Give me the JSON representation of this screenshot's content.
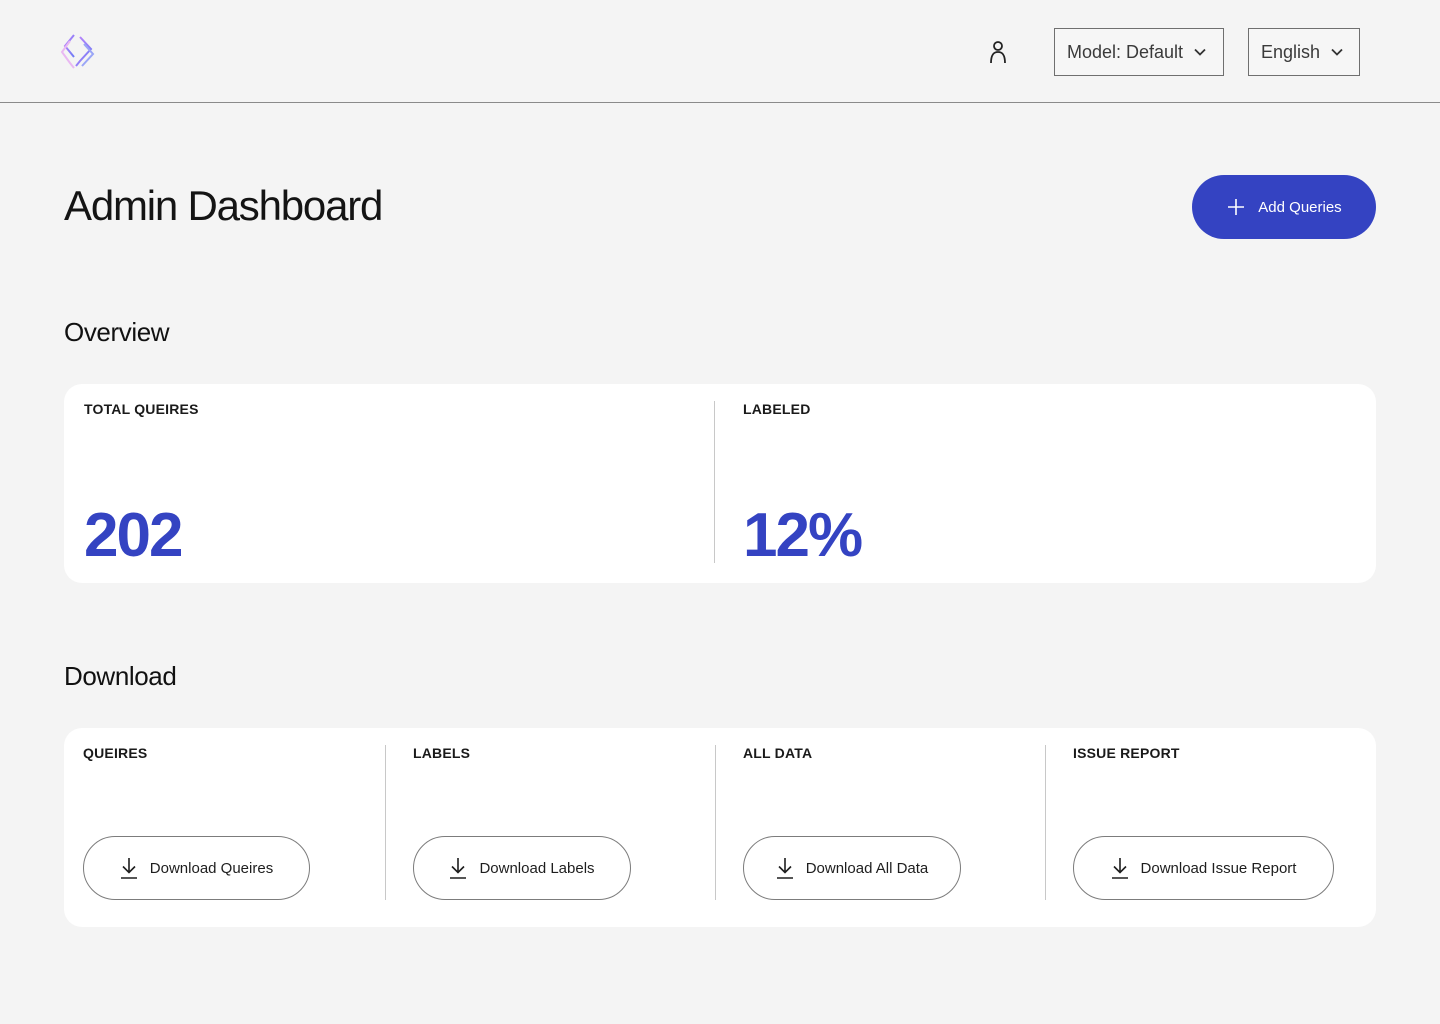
{
  "header": {
    "logo_icon": "logo-chevrons-icon",
    "user_icon": "user-icon",
    "model_select": {
      "value": "Model: Default"
    },
    "language_select": {
      "value": "English"
    }
  },
  "page": {
    "title": "Admin Dashboard",
    "add_button": {
      "label": "Add Queries",
      "icon": "plus-icon"
    }
  },
  "overview": {
    "title": "Overview",
    "stats": [
      {
        "label": "TOTAL QUEIRES",
        "value": "202"
      },
      {
        "label": "LABELED",
        "value": "12%"
      }
    ]
  },
  "download": {
    "title": "Download",
    "items": [
      {
        "label": "QUEIRES",
        "button": "Download Queires",
        "icon": "download-icon"
      },
      {
        "label": "LABELS",
        "button": "Download Labels",
        "icon": "download-icon"
      },
      {
        "label": "ALL DATA",
        "button": "Download All Data",
        "icon": "download-icon"
      },
      {
        "label": "ISSUE REPORT",
        "button": "Download Issue Report",
        "icon": "download-icon"
      }
    ]
  },
  "colors": {
    "accent": "#3443c2",
    "background": "#f4f4f4",
    "card": "#ffffff"
  }
}
